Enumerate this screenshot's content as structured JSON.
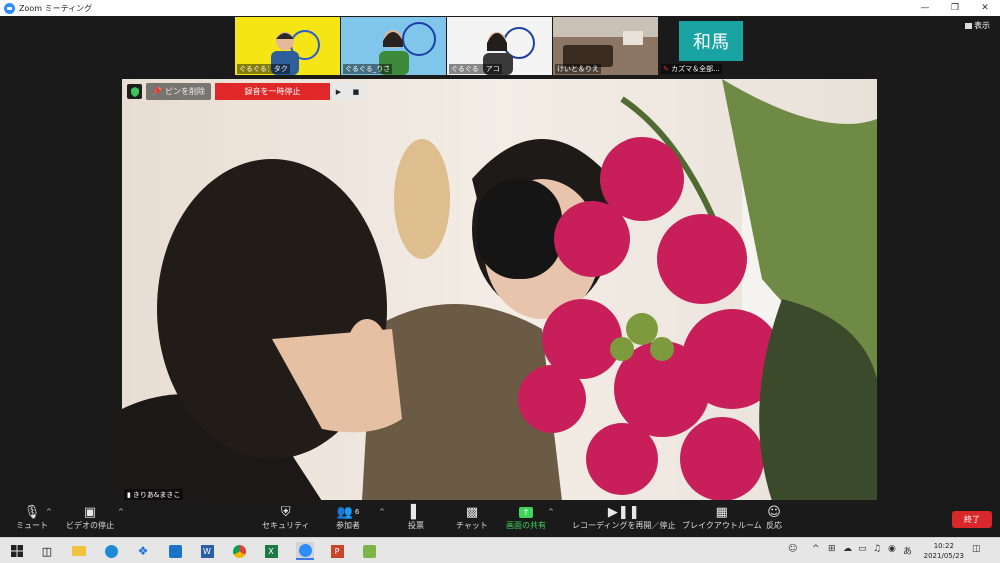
{
  "window": {
    "title": "Zoom ミーティング"
  },
  "thumbnails": [
    {
      "name": "ぐるぐる：タク",
      "bg": "#f5e515"
    },
    {
      "name": "ぐるぐる_りさ",
      "bg": "#7fc6ea"
    },
    {
      "name": "ぐるぐる　アコ",
      "bg": "#f4f4f4"
    },
    {
      "name": "けいと＆りえ",
      "bg": "#6d5a4a"
    },
    {
      "name": "カズマ＆全部...",
      "avatar": "和馬",
      "bg": "#1a1a1a",
      "avatar_bg": "#1aa3a3"
    }
  ],
  "view_button": "表示",
  "main_video": {
    "pin_label": "ピンを削除",
    "record_label": "録音を一時停止",
    "participant_name": "きりあ&まきこ"
  },
  "toolbar": {
    "mute": "ミュート",
    "video": "ビデオの停止",
    "security": "セキュリティ",
    "participants": "参加者",
    "participants_count": "6",
    "poll": "投票",
    "chat": "チャット",
    "share": "画面の共有",
    "recording": "レコーディングを再開／停止",
    "breakout": "ブレイクアウトルーム",
    "reactions": "反応",
    "end": "終了"
  },
  "taskbar": {
    "time": "10:22",
    "date": "2021/05/23",
    "ime": "あ"
  },
  "colors": {
    "accent_green": "#42d35c",
    "record_red": "#e02828",
    "end_red": "#d9282b"
  }
}
